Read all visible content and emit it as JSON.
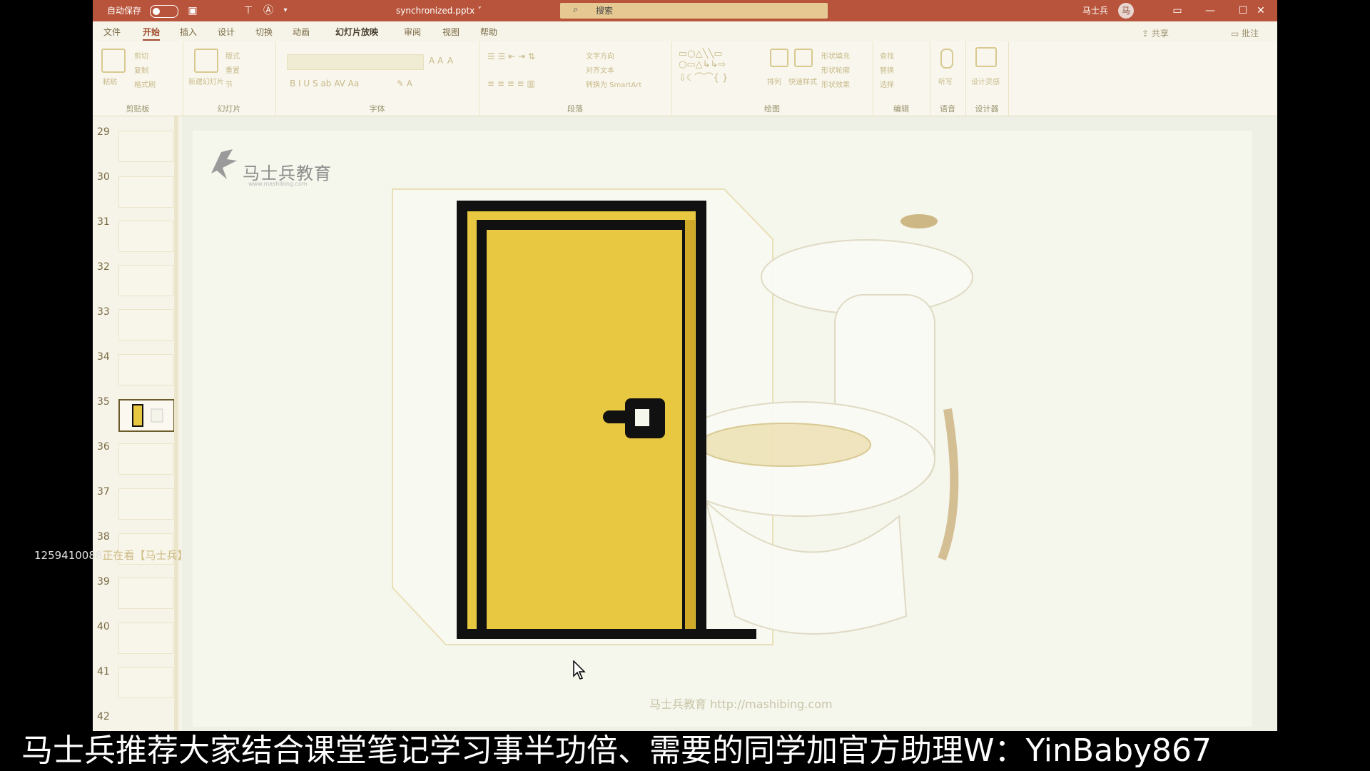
{
  "titlebar": {
    "autosave_label": "自动保存",
    "doc_title": "synchronized.pptx ˅",
    "search_placeholder": "搜索",
    "user_name": "马士兵",
    "avatar_initial": "马",
    "minimize": "—",
    "maximize": "☐",
    "close": "✕"
  },
  "tabs": [
    "文件",
    "开始",
    "插入",
    "设计",
    "切换",
    "动画",
    "幻灯片放映",
    "审阅",
    "视图",
    "帮助"
  ],
  "active_tab": "开始",
  "share": {
    "share_label": "共享",
    "comment_label": "批注"
  },
  "ribbon": {
    "groups": {
      "clipboard": "剪贴板",
      "slides": "幻灯片",
      "font": "字体",
      "paragraph": "段落",
      "drawing": "绘图",
      "editing": "编辑",
      "voice": "语音",
      "designer": "设计器"
    },
    "clipboard_items": [
      "粘贴",
      "剪切",
      "复制",
      "格式刷"
    ],
    "slides_items": [
      "新建幻灯片",
      "版式",
      "重置",
      "节"
    ],
    "paragraph_items": [
      "文字方向",
      "对齐文本",
      "转换为 SmartArt"
    ],
    "drawing_items": [
      "排列",
      "快速样式",
      "形状填充",
      "形状轮廓",
      "形状效果"
    ],
    "editing_items": [
      "查找",
      "替换",
      "选择"
    ],
    "voice_items": [
      "听写"
    ],
    "designer_items": [
      "设计灵感"
    ]
  },
  "slides": {
    "numbers": [
      "29",
      "30",
      "31",
      "32",
      "33",
      "34",
      "35",
      "36",
      "37",
      "38",
      "39",
      "40",
      "41",
      "42"
    ],
    "selected": "35"
  },
  "slide": {
    "logo_text": "马士兵教育",
    "logo_sub": "www.mashibing.com",
    "footer": "马士兵教育 http://mashibing.com"
  },
  "overlay": {
    "side_note_id": "1259410088",
    "side_note_text": "正在看【马士兵】",
    "subtitle": "马士兵推荐大家结合课堂笔记学习事半功倍、需要的同学加官方助理W：YinBaby867"
  },
  "colors": {
    "titlebar": "#b8543b",
    "door_yellow": "#e8c840",
    "door_outline": "#111111",
    "slide_bg": "#f5f6ec"
  }
}
